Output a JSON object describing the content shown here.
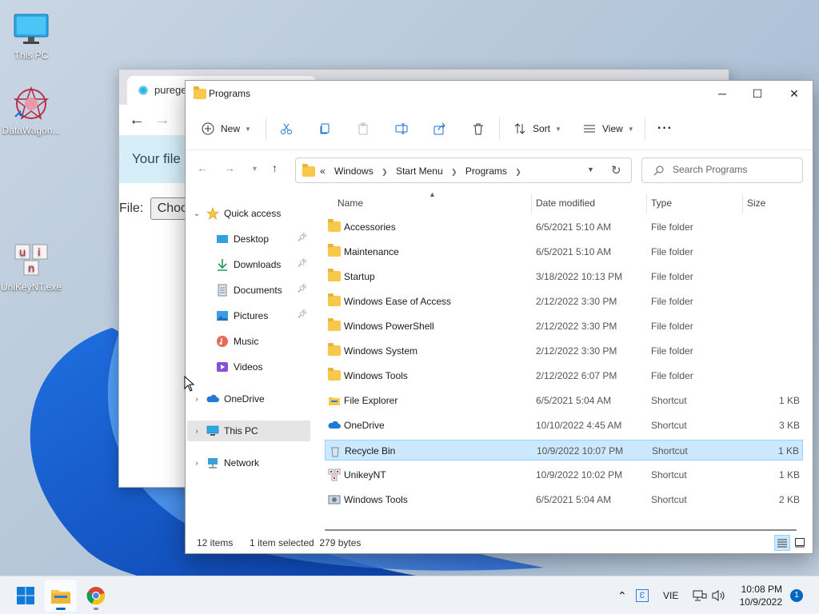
{
  "desktop": {
    "icons": [
      {
        "label": "This PC",
        "icon": "monitor-icon"
      },
      {
        "label": "DataWagon...",
        "icon": "datawagon-icon"
      },
      {
        "label": "UniKeyNT.exe",
        "icon": "unikey-icon"
      }
    ]
  },
  "browser": {
    "tab_title": "purege",
    "notice": "Your file is",
    "file_label": "File:",
    "choose_label": "Choos"
  },
  "explorer": {
    "title": "Programs",
    "controls": {
      "minimize": "─",
      "maximize": "☐",
      "close": "✕"
    },
    "toolbar": {
      "new_label": "New",
      "sort_label": "Sort",
      "view_label": "View",
      "more_label": "···"
    },
    "address": {
      "prefix": "«",
      "crumbs": [
        "Windows",
        "Start Menu",
        "Programs"
      ]
    },
    "search": {
      "placeholder": "Search Programs"
    },
    "nav": {
      "quick_access": "Quick access",
      "items": [
        {
          "label": "Desktop",
          "icon": "desktop-icon",
          "pinned": true
        },
        {
          "label": "Downloads",
          "icon": "download-icon",
          "pinned": true
        },
        {
          "label": "Documents",
          "icon": "documents-icon",
          "pinned": true
        },
        {
          "label": "Pictures",
          "icon": "pictures-icon",
          "pinned": true
        },
        {
          "label": "Music",
          "icon": "music-icon",
          "pinned": false
        },
        {
          "label": "Videos",
          "icon": "videos-icon",
          "pinned": false
        }
      ],
      "onedrive": "OneDrive",
      "this_pc": "This PC",
      "network": "Network"
    },
    "columns": {
      "name": "Name",
      "date": "Date modified",
      "type": "Type",
      "size": "Size"
    },
    "files": [
      {
        "name": "Accessories",
        "date": "6/5/2021 5:10 AM",
        "type": "File folder",
        "size": "",
        "icon": "folder-icon"
      },
      {
        "name": "Maintenance",
        "date": "6/5/2021 5:10 AM",
        "type": "File folder",
        "size": "",
        "icon": "folder-icon"
      },
      {
        "name": "Startup",
        "date": "3/18/2022 10:13 PM",
        "type": "File folder",
        "size": "",
        "icon": "folder-icon"
      },
      {
        "name": "Windows Ease of Access",
        "date": "2/12/2022 3:30 PM",
        "type": "File folder",
        "size": "",
        "icon": "folder-icon"
      },
      {
        "name": "Windows PowerShell",
        "date": "2/12/2022 3:30 PM",
        "type": "File folder",
        "size": "",
        "icon": "folder-icon"
      },
      {
        "name": "Windows System",
        "date": "2/12/2022 3:30 PM",
        "type": "File folder",
        "size": "",
        "icon": "folder-icon"
      },
      {
        "name": "Windows Tools",
        "date": "2/12/2022 6:07 PM",
        "type": "File folder",
        "size": "",
        "icon": "folder-icon"
      },
      {
        "name": "File Explorer",
        "date": "6/5/2021 5:04 AM",
        "type": "Shortcut",
        "size": "1 KB",
        "icon": "file-explorer-shortcut-icon"
      },
      {
        "name": "OneDrive",
        "date": "10/10/2022 4:45 AM",
        "type": "Shortcut",
        "size": "3 KB",
        "icon": "onedrive-shortcut-icon"
      },
      {
        "name": "Recycle Bin",
        "date": "10/9/2022 10:07 PM",
        "type": "Shortcut",
        "size": "1 KB",
        "icon": "recycle-bin-shortcut-icon",
        "selected": true
      },
      {
        "name": "UnikeyNT",
        "date": "10/9/2022 10:02 PM",
        "type": "Shortcut",
        "size": "1 KB",
        "icon": "unikey-shortcut-icon"
      },
      {
        "name": "Windows Tools",
        "date": "6/5/2021 5:04 AM",
        "type": "Shortcut",
        "size": "2 KB",
        "icon": "tools-shortcut-icon"
      }
    ],
    "status": {
      "count": "12 items",
      "selection": "1 item selected  279 bytes"
    }
  },
  "taskbar": {
    "language": "VIE",
    "time": "10:08 PM",
    "date": "10/9/2022",
    "notifications": "1"
  }
}
